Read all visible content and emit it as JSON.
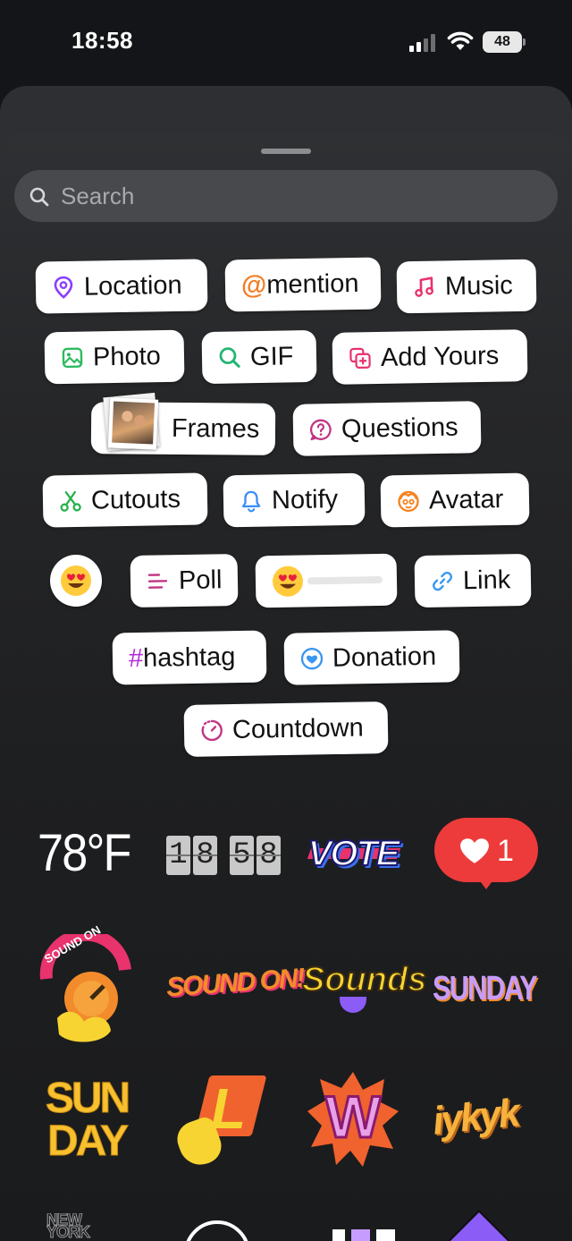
{
  "status_bar": {
    "time": "18:58",
    "battery": "48"
  },
  "search": {
    "placeholder": "Search"
  },
  "stickers": {
    "location": "Location",
    "mention": "mention",
    "mention_prefix": "@",
    "music": "Music",
    "photo": "Photo",
    "gif": "GIF",
    "add_yours": "Add Yours",
    "frames": "Frames",
    "questions": "Questions",
    "cutouts": "Cutouts",
    "notify": "Notify",
    "avatar": "Avatar",
    "poll": "Poll",
    "link": "Link",
    "hashtag": "#hashtag",
    "donation": "Donation",
    "countdown": "Countdown"
  },
  "grid": {
    "temperature": "78°F",
    "clock_digits": [
      "1",
      "8",
      "5",
      "8"
    ],
    "vote": "VOTE",
    "like_count": "1",
    "sound_on_1": "SOUND ON",
    "sound_on_2": "SOUND ON!",
    "sounds": "Sounds",
    "sunday_1": "SUNDAY",
    "sunday_2": "SUN DAY",
    "letter_l": "L",
    "letter_w": "W",
    "ykyk": "iykyk",
    "new_york": "NEW YORK"
  },
  "colors": {
    "location": "#8b3dff",
    "mention": "#f47b20",
    "music": "#e8336d",
    "photo": "#2fbb5f",
    "gif": "#22b573",
    "add_yours": "#e8336d",
    "questions": "#c13584",
    "cutouts": "#27b24a",
    "notify": "#3a8ef6",
    "avatar": "#f58220",
    "poll": "#c13584",
    "link": "#3897f0",
    "hashtag": "#b32ad6",
    "donation": "#3897f0",
    "countdown": "#c13584",
    "like": "#ed3b3b"
  }
}
